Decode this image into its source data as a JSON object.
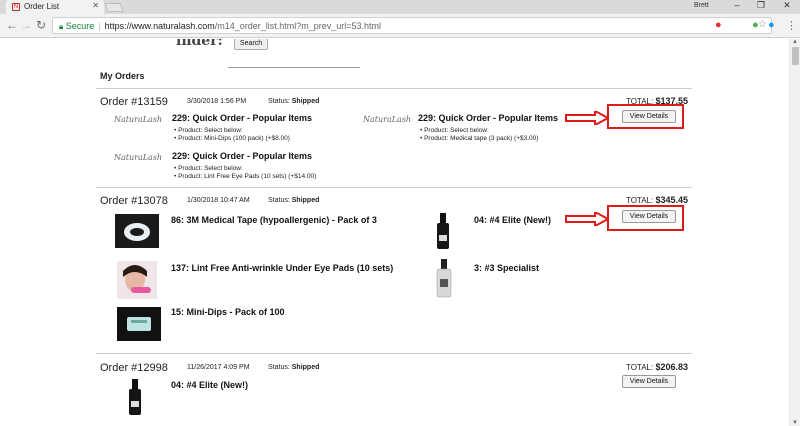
{
  "browser": {
    "tab_title": "Order List",
    "user": "Brett",
    "secure_label": "Secure",
    "url_host": "https://www.naturalash.com",
    "url_rest": "/m14_order_list.html?m_prev_url=53.html"
  },
  "top": {
    "cut_text": "inder:",
    "search_label": "Search"
  },
  "heading": "My Orders",
  "orders": [
    {
      "number": "Order #13159",
      "date": "3/30/2018 1:56 PM",
      "status_label": "Status:",
      "status": "Shipped",
      "total_label": "TOTAL:",
      "total": "$137.55",
      "view_label": "View Details",
      "items": [
        {
          "logo": "NaturaLash",
          "title": "229: Quick Order - Popular Items",
          "lines": [
            "• Product: Select below:",
            "• Product: Mini-Dips (100 pack) (+$8.00)"
          ]
        },
        {
          "logo": "NaturaLash",
          "title": "229: Quick Order - Popular Items",
          "lines": [
            "• Product: Select below:",
            "• Product: Medical tape (3 pack) (+$3.00)"
          ]
        },
        {
          "logo": "NaturaLash",
          "title": "229: Quick Order - Popular Items",
          "lines": [
            "• Product: Select below:",
            "• Product: Lint Free Eye Pads (10 sets) (+$14.00)"
          ]
        }
      ]
    },
    {
      "number": "Order #13078",
      "date": "1/30/2018 10:47 AM",
      "status_label": "Status:",
      "status": "Shipped",
      "total_label": "TOTAL:",
      "total": "$345.45",
      "view_label": "View Details",
      "items": [
        {
          "title": "86: 3M Medical Tape (hypoallergenic) - Pack of 3"
        },
        {
          "title": "04: #4 Elite (New!)"
        },
        {
          "title": "137: Lint Free Anti-wrinkle Under Eye Pads (10 sets)"
        },
        {
          "title": "3: #3 Specialist"
        },
        {
          "title": "15: Mini-Dips - Pack of 100"
        }
      ]
    },
    {
      "number": "Order #12998",
      "date": "11/26/2017 4:09 PM",
      "status_label": "Status:",
      "status": "Shipped",
      "total_label": "TOTAL:",
      "total": "$206.83",
      "view_label": "View Details",
      "items": [
        {
          "title": "04: #4 Elite (New!)"
        }
      ]
    }
  ],
  "annotation_color": "#e01919"
}
